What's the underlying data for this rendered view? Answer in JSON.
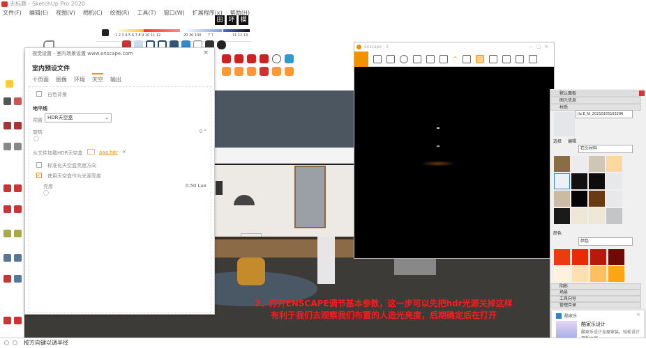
{
  "app": {
    "title": "无标题 - SketchUp Pro 2020"
  },
  "menu": [
    "文件(F)",
    "编辑(E)",
    "视图(V)",
    "相机(C)",
    "绘图(R)",
    "工具(T)",
    "窗口(W)",
    "扩展程序(x)",
    "帮助(H)"
  ],
  "view_toggles": [
    "田",
    "坏",
    "模"
  ],
  "ramp": {
    "ticks_left": "1 2 3 4 5 6 7 8 9 10 11 12",
    "ticks_mid": "20 30 100",
    "ticks_mid2": "7 7",
    "ticks_right": "11 12 13"
  },
  "dialog": {
    "title": "视觉设置 - 室内场景设置 www.enscape.com",
    "preset_name": "室内预设文件",
    "tabs": [
      {
        "label": "十页面"
      },
      {
        "label": "图像"
      },
      {
        "label": "环境"
      },
      {
        "label": "天空",
        "active": true
      },
      {
        "label": "输出"
      }
    ],
    "bg_checkbox": "白色背景",
    "horizon_header": "地平线",
    "preset_label": "预置",
    "preset_value": "HDR天空盒",
    "rotation_label": "旋转",
    "rotation_value": "0 °",
    "load_hdr_label": "从文件加载HDR天空盒",
    "hdr_file": "aaa.hdr",
    "normalize_label": "标准化天空盒亮度方向",
    "use_skybox_light_label": "使用天空盒作为光源亮度",
    "brightness_label": "亮度",
    "brightness_value": "0.50 Lux"
  },
  "enscape": {
    "title": "Enscape - 3"
  },
  "right_panel": {
    "header": "默认面板",
    "sections": [
      "图元信息",
      "材质"
    ],
    "material_name": "Jia E_Ni_20210105163296",
    "tabs": [
      "选择",
      "编辑"
    ],
    "library": "石头材料",
    "colors_header": "颜色",
    "color_library": "颜色",
    "collapsed": [
      "阴影",
      "场景",
      "工具向导",
      "管理目录"
    ],
    "colors": [
      "#ee3a10",
      "#e52b0a",
      "#b51a0a",
      "#6f0b07",
      "#fdf3dd",
      "#fddfb0",
      "#fdbf60",
      "#fca612"
    ]
  },
  "toast": {
    "app": "酷家乐",
    "title": "酷家乐设计",
    "body": "酷家乐设计全屋家装，轻松设计理想之家"
  },
  "caption": {
    "line1": "2、打开ENSCAPE调节基本参数，这一步可以先把hdr光源关掉这样",
    "line2": "有利于我们去观察我们布置的人造光亮度，后期确定后在打开"
  },
  "status": {
    "text": "按方向键以调半径"
  }
}
